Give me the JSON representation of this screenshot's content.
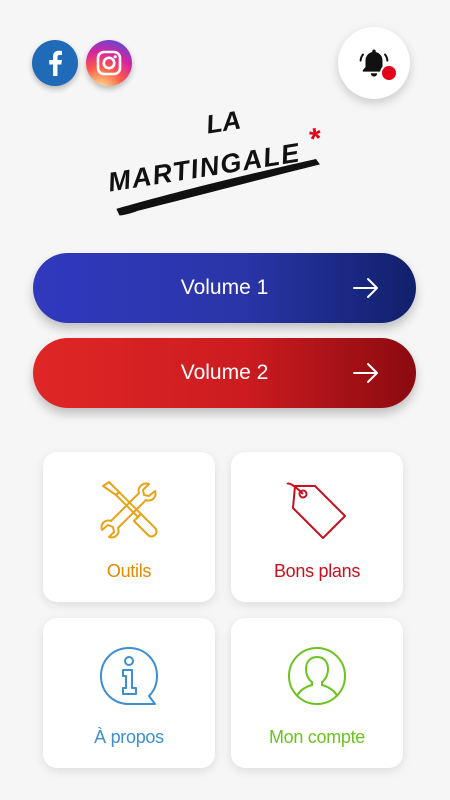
{
  "social": {
    "facebook_icon": "facebook-icon",
    "instagram_icon": "instagram-icon"
  },
  "notifications": {
    "icon": "bell-icon",
    "has_badge": true,
    "badge_color": "#e3001b"
  },
  "logo": {
    "line1": "LA",
    "line2": "MARTINGALE",
    "asterisk": "*",
    "asterisk_color": "#e3001b"
  },
  "volumes": [
    {
      "label": "Volume 1",
      "icon": "arrow-right-icon",
      "color": "#2a35a8"
    },
    {
      "label": "Volume 2",
      "icon": "arrow-right-icon",
      "color": "#cc1c20"
    }
  ],
  "tiles": [
    {
      "label": "Outils",
      "icon": "tools-icon",
      "color": "#e08a00"
    },
    {
      "label": "Bons plans",
      "icon": "price-tag-icon",
      "color": "#c8101f"
    },
    {
      "label": "À propos",
      "icon": "info-bubble-icon",
      "color": "#3d8fd0"
    },
    {
      "label": "Mon compte",
      "icon": "user-profile-icon",
      "color": "#6cc31f"
    }
  ]
}
